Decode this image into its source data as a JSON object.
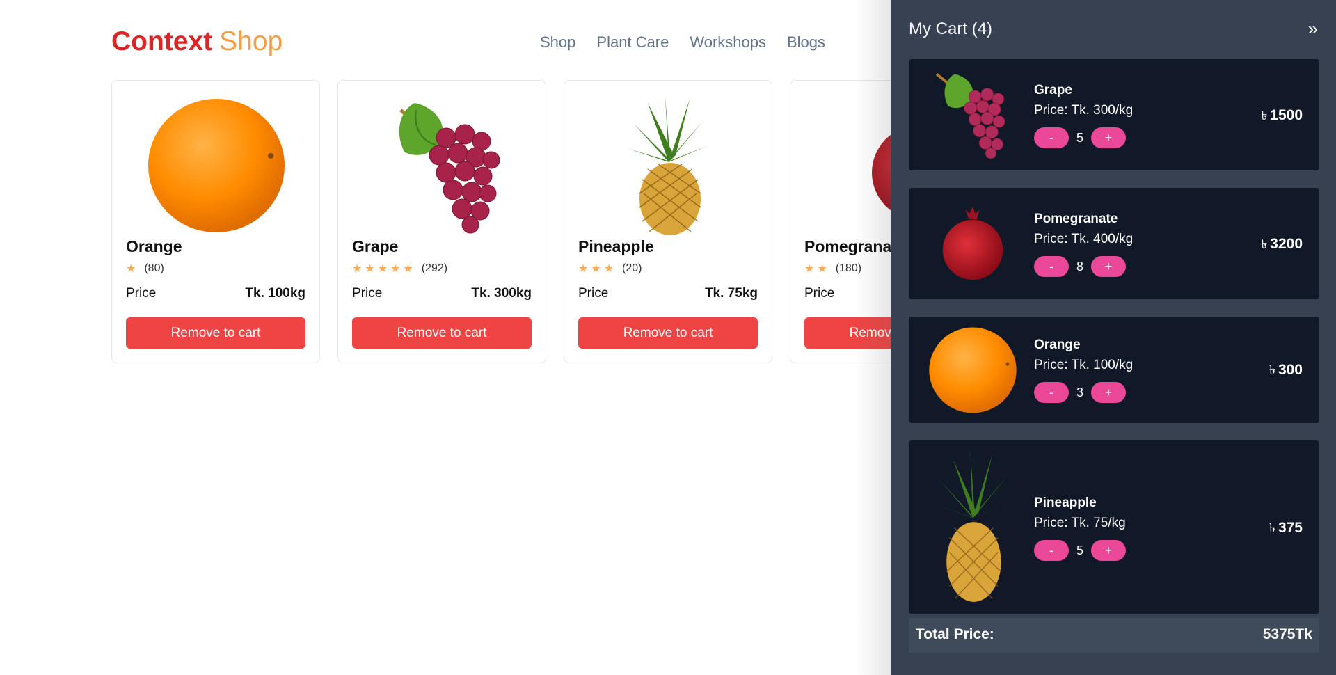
{
  "brand": {
    "part1": "Context",
    "part2": "Shop"
  },
  "nav": [
    "Shop",
    "Plant Care",
    "Workshops",
    "Blogs"
  ],
  "products": [
    {
      "name": "Orange",
      "stars": 1,
      "reviews": "(80)",
      "price_label": "Price",
      "price": "Tk. 100kg",
      "button": "Remove to cart",
      "icon": "orange-icon"
    },
    {
      "name": "Grape",
      "stars": 5,
      "reviews": "(292)",
      "price_label": "Price",
      "price": "Tk. 300kg",
      "button": "Remove to cart",
      "icon": "grape-icon"
    },
    {
      "name": "Pineapple",
      "stars": 3,
      "reviews": "(20)",
      "price_label": "Price",
      "price": "Tk. 75kg",
      "button": "Remove to cart",
      "icon": "pineapple-icon"
    },
    {
      "name": "Pomegranate",
      "stars": 2,
      "reviews": "(180)",
      "price_label": "Price",
      "price": "",
      "button": "Remove to cart",
      "icon": "pomegranate-icon"
    }
  ],
  "cart": {
    "title": "My Cart (4)",
    "close_icon": "double-chevron-right-icon",
    "currency_symbol": "৳",
    "minus": "-",
    "plus": "+",
    "items": [
      {
        "name": "Grape",
        "price": "Price: Tk. 300/kg",
        "qty": "5",
        "total": "1500",
        "icon": "grape-icon"
      },
      {
        "name": "Pomegranate",
        "price": "Price: Tk. 400/kg",
        "qty": "8",
        "total": "3200",
        "icon": "pomegranate-icon"
      },
      {
        "name": "Orange",
        "price": "Price: Tk. 100/kg",
        "qty": "3",
        "total": "300",
        "icon": "orange-icon"
      },
      {
        "name": "Pineapple",
        "price": "Price: Tk. 75/kg",
        "qty": "5",
        "total": "375",
        "icon": "pineapple-icon"
      }
    ],
    "total_label": "Total Price:",
    "total_value": "5375Tk"
  },
  "colors": {
    "accent_red": "#ef4444",
    "brand_orange": "#f59e42",
    "qty_pink": "#ec4899",
    "drawer_bg": "#374151",
    "item_bg": "#111827",
    "star": "#f6ad55"
  }
}
